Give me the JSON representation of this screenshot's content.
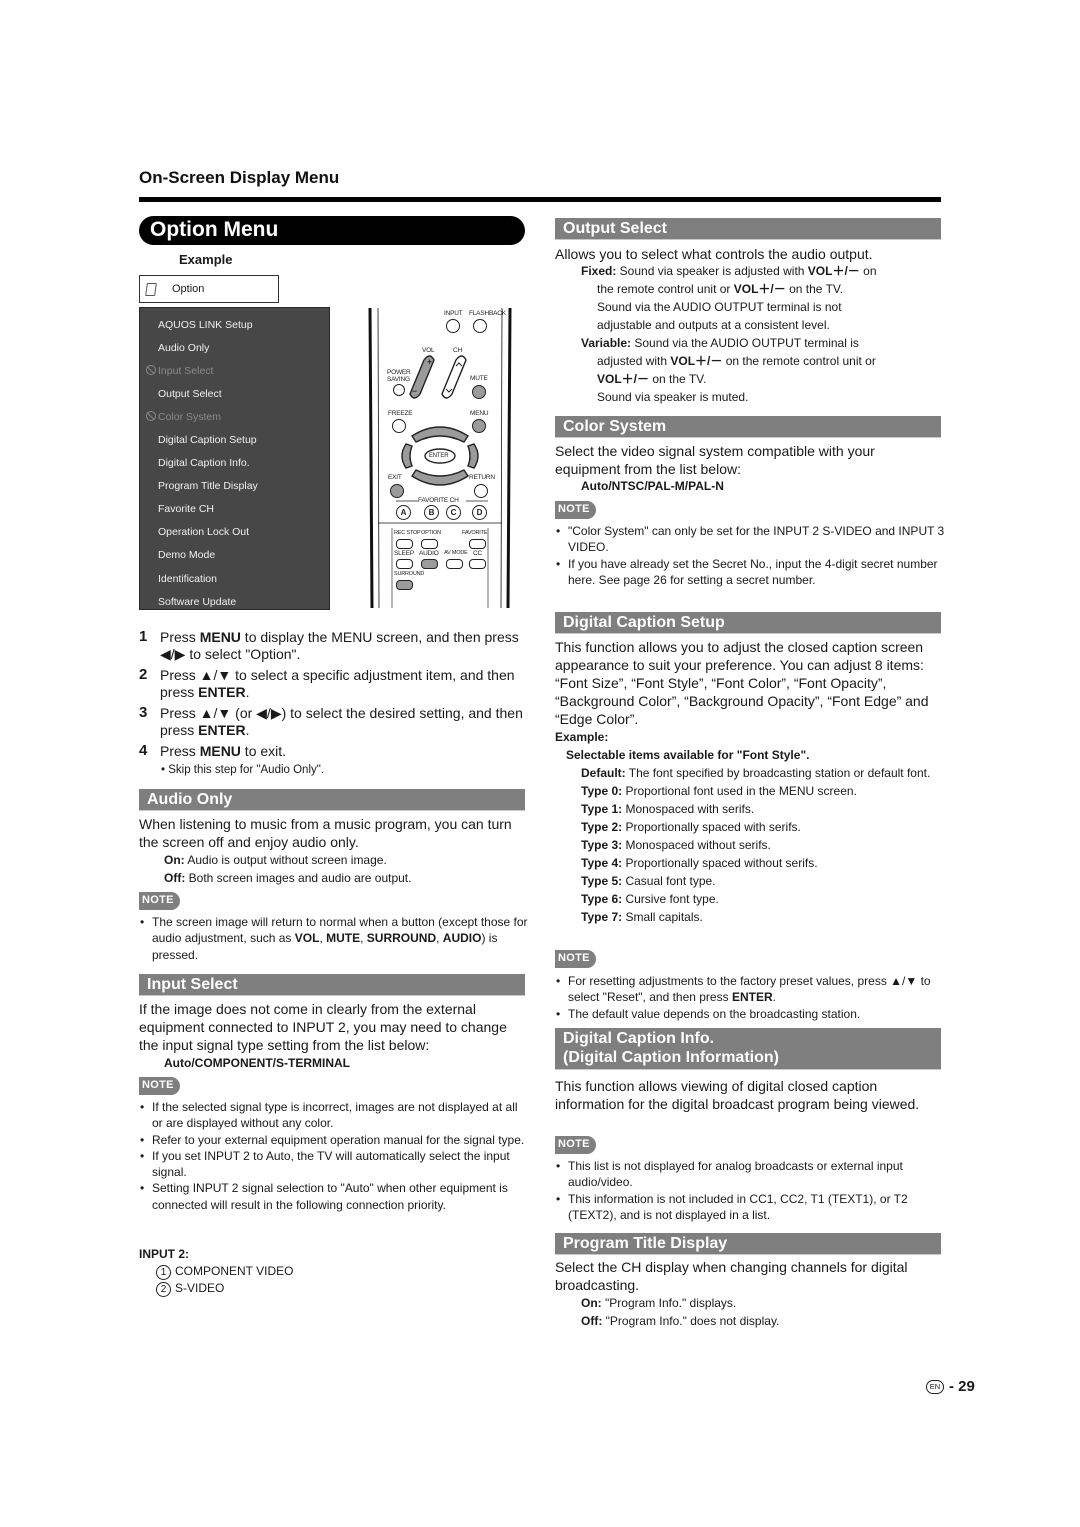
{
  "header": {
    "section_title": "On-Screen Display Menu",
    "menu_title": "Option Menu"
  },
  "example": {
    "label": "Example",
    "option_box_label": "Option",
    "option_icon": "option-card-icon",
    "menu_items": [
      {
        "label": "AQUOS LINK Setup",
        "disabled": false
      },
      {
        "label": "Audio Only",
        "disabled": false
      },
      {
        "label": "Input Select",
        "disabled": true
      },
      {
        "label": "Output Select",
        "disabled": false
      },
      {
        "label": "Color System",
        "disabled": true
      },
      {
        "label": "Digital Caption Setup",
        "disabled": false
      },
      {
        "label": "Digital Caption Info.",
        "disabled": false
      },
      {
        "label": "Program Title Display",
        "disabled": false
      },
      {
        "label": "Favorite CH",
        "disabled": false
      },
      {
        "label": "Operation Lock Out",
        "disabled": false
      },
      {
        "label": "Demo Mode",
        "disabled": false
      },
      {
        "label": "Identification",
        "disabled": false
      },
      {
        "label": "Software Update",
        "disabled": false
      }
    ]
  },
  "remote": {
    "input": "INPUT",
    "flashback": "FLASHBACK",
    "vol": "VOL",
    "ch": "CH",
    "power_saving": "POWER SAVING",
    "mute": "MUTE",
    "freeze": "FREEZE",
    "menu": "MENU",
    "enter": "ENTER",
    "exit": "EXIT",
    "return": "RETURN",
    "favorite_ch": "FAVORITE CH",
    "letters": [
      "A",
      "B",
      "C",
      "D"
    ],
    "rec_stop": "REC STOP",
    "option": "OPTION",
    "favorite": "FAVORITE",
    "sleep": "SLEEP",
    "audio": "AUDIO",
    "av_mode": "AV MODE",
    "cc": "CC",
    "surround": "SURROUND"
  },
  "steps": [
    {
      "num": "1",
      "pre": "Press ",
      "bold": "MENU",
      "post": " to display the MENU screen, and then press ◀/▶ to select \"Option\"."
    },
    {
      "num": "2",
      "pre": "Press ▲/▼ to select a specific adjustment item, and then press ",
      "bold": "ENTER",
      "post": "."
    },
    {
      "num": "3",
      "pre": "Press ▲/▼ (or ◀/▶) to select the desired setting, and then press ",
      "bold": "ENTER",
      "post": "."
    },
    {
      "num": "4",
      "pre": "Press ",
      "bold": "MENU",
      "post": " to exit."
    }
  ],
  "step_subnote": "• Skip this step for \"Audio Only\".",
  "note_label": "NOTE",
  "audio_only": {
    "title": "Audio Only",
    "intro": "When listening to music from a music program, you can turn the screen off and enjoy audio only.",
    "on_label": "On:",
    "on_text": " Audio is output without screen image.",
    "off_label": "Off:",
    "off_text": " Both screen images and audio are output.",
    "note_pre": "The screen image will return to normal when a button (except those for audio adjustment, such as ",
    "note_b1": "VOL",
    "note_b2": "MUTE",
    "note_b3": "SURROUND",
    "note_b4": "AUDIO",
    "note_post": ") is pressed."
  },
  "input_select": {
    "title": "Input Select",
    "intro": "If the image does not come in clearly from the external equipment connected to INPUT 2, you may need to change the input signal type setting from the list below:",
    "options": "Auto/COMPONENT/S-TERMINAL",
    "notes": [
      "If the selected signal type is incorrect, images are not displayed at all or are displayed without any color.",
      "Refer to your external equipment operation manual for the signal type.",
      "If you set INPUT 2 to Auto, the TV will automatically select the input signal.",
      "Setting INPUT 2 signal selection to \"Auto\" when other equipment is connected will result in the following connection priority."
    ],
    "priority_label": "INPUT 2:",
    "priority": [
      {
        "n": "1",
        "label": "COMPONENT VIDEO"
      },
      {
        "n": "2",
        "label": "S-VIDEO"
      }
    ]
  },
  "output_select": {
    "title": "Output Select",
    "intro": "Allows you to select what controls the audio output.",
    "fixed_label": "Fixed:",
    "fixed_l1_pre": " Sound via speaker is adjusted with ",
    "fixed_l1_b": "VOL＋/－",
    "fixed_l1_post": " on",
    "fixed_l2_pre": "the remote control unit or ",
    "fixed_l2_b": "VOL＋/－",
    "fixed_l2_post": " on the TV.",
    "fixed_l3": "Sound via the AUDIO OUTPUT terminal is not",
    "fixed_l4": "adjustable and outputs at a consistent level.",
    "variable_label": "Variable:",
    "var_l1": " Sound via the AUDIO OUTPUT terminal is",
    "var_l2_pre": "adjusted with ",
    "var_l2_b": "VOL＋/－",
    "var_l2_post": " on the remote control unit or",
    "var_l3_b": "VOL＋/－",
    "var_l3_post": " on the TV.",
    "var_l4": "Sound via speaker is muted."
  },
  "color_system": {
    "title": "Color System",
    "intro": "Select the video signal system compatible with your equipment from the list below:",
    "options": "Auto/NTSC/PAL-M/PAL-N",
    "notes": [
      "\"Color System\" can only be set for the INPUT 2 S-VIDEO and INPUT 3 VIDEO.",
      "If you have already set the Secret No., input the 4-digit secret number here. See page 26 for setting a secret number."
    ]
  },
  "digital_caption_setup": {
    "title": "Digital Caption Setup",
    "intro": "This function allows you to adjust the closed caption screen appearance to suit your preference. You can adjust 8 items: “Font Size”, “Font Style”, “Font Color”, “Font Opacity”, “Background Color”, “Background Opacity”, “Font Edge” and “Edge Color”.",
    "example_label": "Example:",
    "selectable_label": "Selectable items available for \"Font Style\".",
    "items": [
      {
        "label": "Default:",
        "text": " The font specified by broadcasting station or default font."
      },
      {
        "label": "Type 0:",
        "text": " Proportional font used in the MENU screen."
      },
      {
        "label": "Type 1:",
        "text": " Monospaced with serifs."
      },
      {
        "label": "Type 2:",
        "text": " Proportionally spaced with serifs."
      },
      {
        "label": "Type 3:",
        "text": " Monospaced without serifs."
      },
      {
        "label": "Type 4:",
        "text": " Proportionally spaced without serifs."
      },
      {
        "label": "Type 5:",
        "text": " Casual font type."
      },
      {
        "label": "Type 6:",
        "text": " Cursive font type."
      },
      {
        "label": "Type 7:",
        "text": " Small capitals."
      }
    ],
    "note1_pre": "For resetting adjustments to the factory preset values, press ▲/▼ to select \"Reset\", and then press ",
    "note1_b": "ENTER",
    "note1_post": ".",
    "note2": "The default value depends on the broadcasting station."
  },
  "digital_caption_info": {
    "title_line1": "Digital Caption Info.",
    "title_line2": "(Digital Caption Information)",
    "intro": "This function allows viewing of digital closed caption information for the digital broadcast program being viewed.",
    "notes": [
      "This list is not displayed for analog broadcasts or external input audio/video.",
      "This information is not included in CC1, CC2, T1 (TEXT1), or T2 (TEXT2), and is not displayed in a list."
    ]
  },
  "program_title_display": {
    "title": "Program Title Display",
    "intro": "Select the CH display when changing channels for digital broadcasting.",
    "on_label": "On:",
    "on_text": " \"Program Info.\" displays.",
    "off_label": "Off:",
    "off_text": " \"Program Info.\" does not display."
  },
  "footer": {
    "lang_badge": "EN",
    "page_number": "- 29"
  },
  "colors": {
    "section_bar": "#7f7f7f",
    "menu_panel": "#474747",
    "pill": "#000000"
  }
}
